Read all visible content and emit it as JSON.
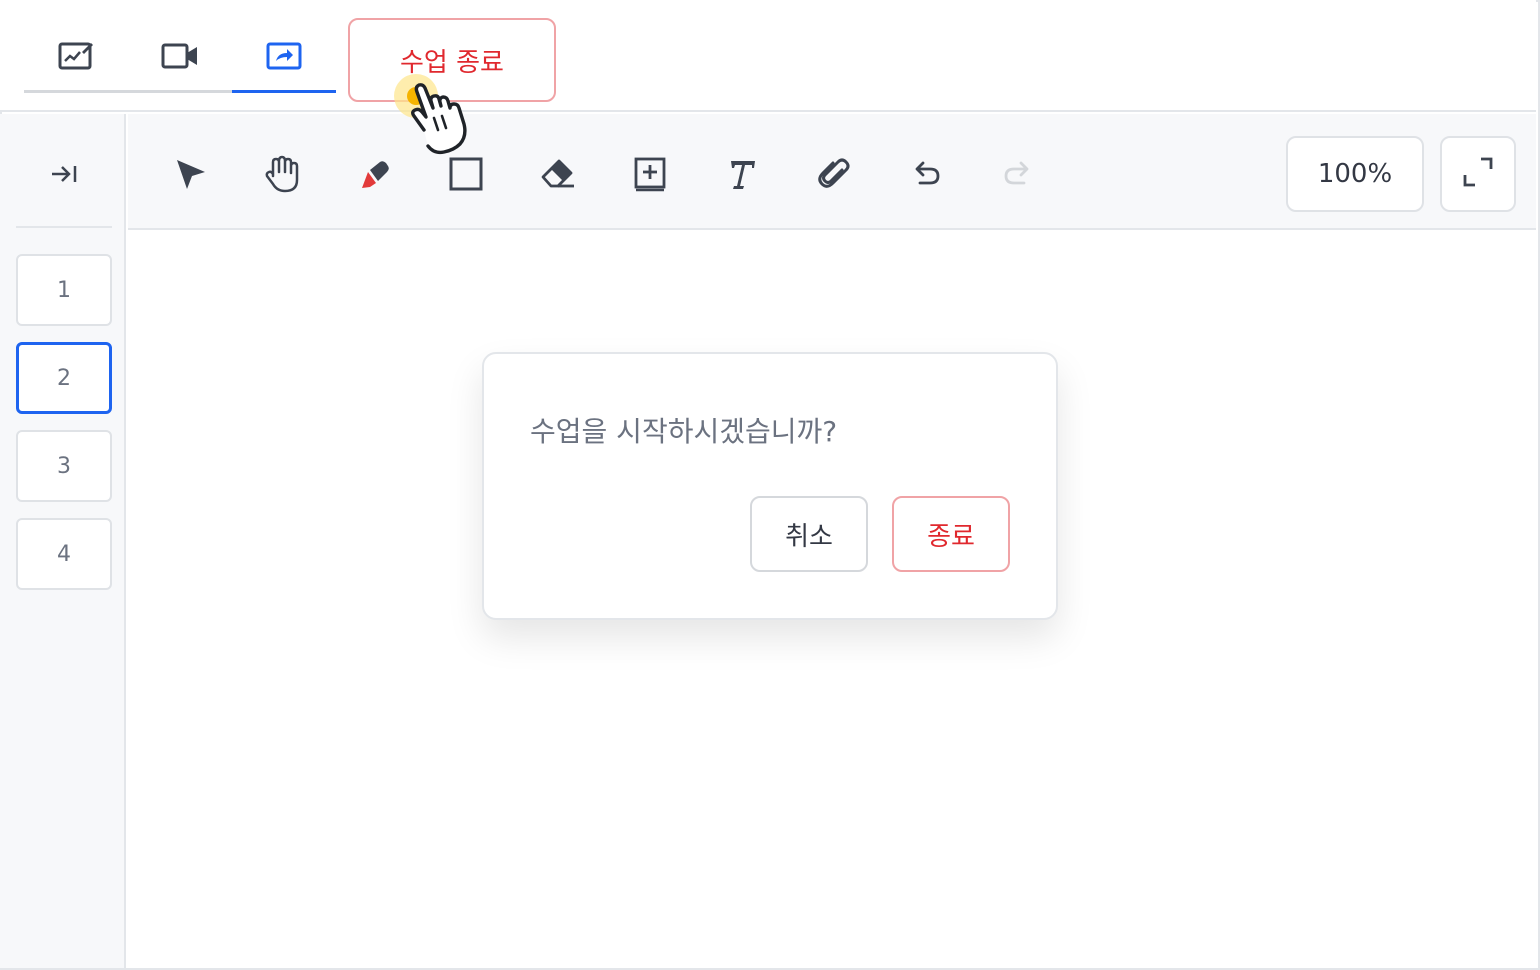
{
  "header": {
    "tabs": [
      {
        "icon": "whiteboard-icon",
        "active": false
      },
      {
        "icon": "video-camera-icon",
        "active": false
      },
      {
        "icon": "screen-share-icon",
        "active": true
      }
    ],
    "end_class_label": "수업 종료"
  },
  "sidebar": {
    "collapse_icon": "collapse-right-icon",
    "pages": [
      {
        "label": "1",
        "active": false
      },
      {
        "label": "2",
        "active": true
      },
      {
        "label": "3",
        "active": false
      },
      {
        "label": "4",
        "active": false
      }
    ]
  },
  "toolbar": {
    "tools": [
      {
        "icon": "select-arrow-icon"
      },
      {
        "icon": "hand-pan-icon"
      },
      {
        "icon": "highlighter-icon"
      },
      {
        "icon": "rectangle-icon"
      },
      {
        "icon": "eraser-icon"
      },
      {
        "icon": "add-page-icon"
      },
      {
        "icon": "text-icon"
      },
      {
        "icon": "attachment-icon"
      },
      {
        "icon": "undo-icon"
      },
      {
        "icon": "redo-icon",
        "disabled": true
      }
    ],
    "zoom_label": "100%",
    "fullscreen_icon": "fullscreen-icon"
  },
  "dialog": {
    "message": "수업을 시작하시겠습니까?",
    "cancel_label": "취소",
    "confirm_label": "종료"
  },
  "colors": {
    "accent": "#1e64f0",
    "danger": "#e0282e",
    "danger_border": "#f0a3a6",
    "icon": "#3d4450"
  }
}
